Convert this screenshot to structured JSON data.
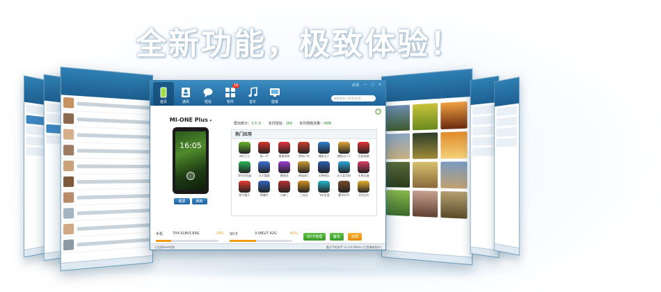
{
  "headline": "全新功能，极致体验！",
  "colors": {
    "accent": "#1e6399",
    "progress": "#f29a16",
    "badge": "#e13b2c",
    "ok": "#3a9a2a"
  },
  "main_window": {
    "nav": [
      {
        "label": "首页",
        "icon": "phone-icon",
        "active": true
      },
      {
        "label": "通讯",
        "icon": "contacts-icon"
      },
      {
        "label": "短信",
        "icon": "sms-icon"
      },
      {
        "label": "软件",
        "icon": "apps-icon",
        "badge": "18"
      },
      {
        "label": "音乐",
        "icon": "music-icon"
      },
      {
        "label": "壁纸",
        "icon": "wallpaper-icon"
      }
    ],
    "window_controls": [
      "反馈",
      "—",
      "□",
      "✕"
    ],
    "search_placeholder": "搜索联系人/短信/应用",
    "device": {
      "name": "MI-ONE Plus",
      "clock": "16:05",
      "screenshot_button": "截屏",
      "refresh_button": "刷新"
    },
    "stats": [
      {
        "label": "帮出统计：",
        "value": "3.0 分"
      },
      {
        "label": "本月短信：",
        "value": "189"
      },
      {
        "label": "本月网络流量：",
        "value": "0MB"
      }
    ],
    "hot_apps": {
      "title": "热门应用",
      "apps": [
        {
          "name": "360卫士",
          "color": "#67b52b"
        },
        {
          "name": "新一代",
          "color": "#d9342b"
        },
        {
          "name": "搜狐视频",
          "color": "#e2333a"
        },
        {
          "name": "愤怒小鸟",
          "color": "#c8402a"
        },
        {
          "name": "捕鱼达人",
          "color": "#2f7fd0"
        },
        {
          "name": "捕鱼达人2",
          "color": "#e0a43a"
        },
        {
          "name": "百度地图",
          "color": "#e03131"
        },
        {
          "name": "360浏览器",
          "color": "#2db35a"
        },
        {
          "name": "天天酷跑",
          "color": "#3b6fd6"
        },
        {
          "name": "植物战",
          "color": "#9a3bd0"
        },
        {
          "name": "神庙逃亡",
          "color": "#c99a32"
        },
        {
          "name": "天降神兵",
          "color": "#2c5db0"
        },
        {
          "name": "天天爱消除",
          "color": "#2ba6d8"
        },
        {
          "name": "水果忍者",
          "color": "#d93e63"
        },
        {
          "name": "快手看片",
          "color": "#e53b2d"
        },
        {
          "name": "降魔传",
          "color": "#3563b8"
        },
        {
          "name": "大掌门",
          "color": "#b83131"
        },
        {
          "name": "三国志",
          "color": "#d18e1f"
        },
        {
          "name": "飞车竞速",
          "color": "#27b6c9"
        },
        {
          "name": "魔术时代",
          "color": "#7a4a2c"
        },
        {
          "name": "QQ空间",
          "color": "#e8b02b"
        }
      ]
    },
    "storage": {
      "phone_label": "手机",
      "phone_value": "704.91M/3.89G",
      "phone_pct": 24,
      "phone_pct_label": "24%",
      "sd_label": "SD卡",
      "sd_value": "3.08G/7.42G",
      "sd_pct": 42,
      "sd_pct_label": "42%",
      "sd_manage": "SD卡管理",
      "backup": "备份",
      "restore": "还原"
    },
    "status_left": "已连接Root权限",
    "status_right": "魔方手机助手  v1.0.0.0Beta  (已是最新版本)"
  }
}
